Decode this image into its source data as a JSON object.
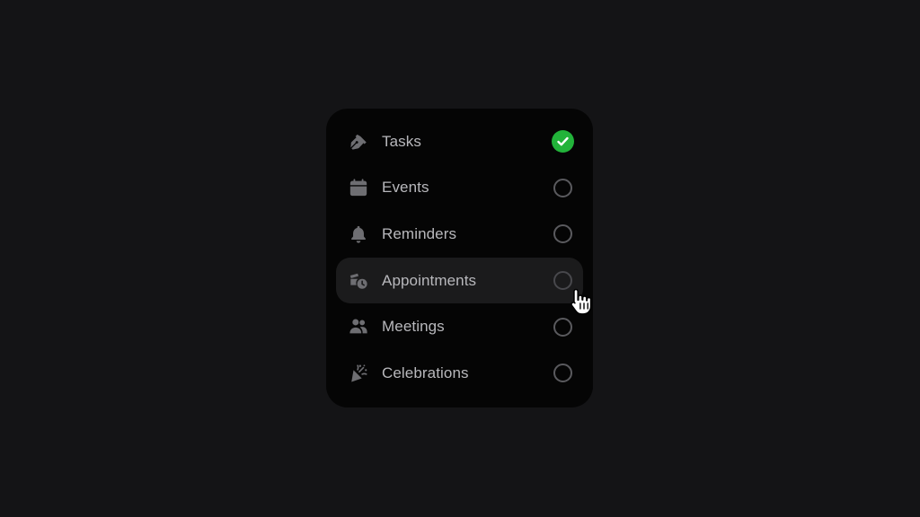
{
  "colors": {
    "background": "#141416",
    "card": "#050505",
    "hover_row": "#1b1b1c",
    "check_on": "#22b33a",
    "icon": "#6e6e72"
  },
  "items": [
    {
      "label": "Tasks",
      "icon": "pen-icon",
      "checked": true
    },
    {
      "label": "Events",
      "icon": "calendar-icon",
      "checked": false
    },
    {
      "label": "Reminders",
      "icon": "bell-icon",
      "checked": false
    },
    {
      "label": "Appointments",
      "icon": "clock-stack-icon",
      "checked": false,
      "hovered": true
    },
    {
      "label": "Meetings",
      "icon": "people-icon",
      "checked": false
    },
    {
      "label": "Celebrations",
      "icon": "party-popper-icon",
      "checked": false
    }
  ]
}
